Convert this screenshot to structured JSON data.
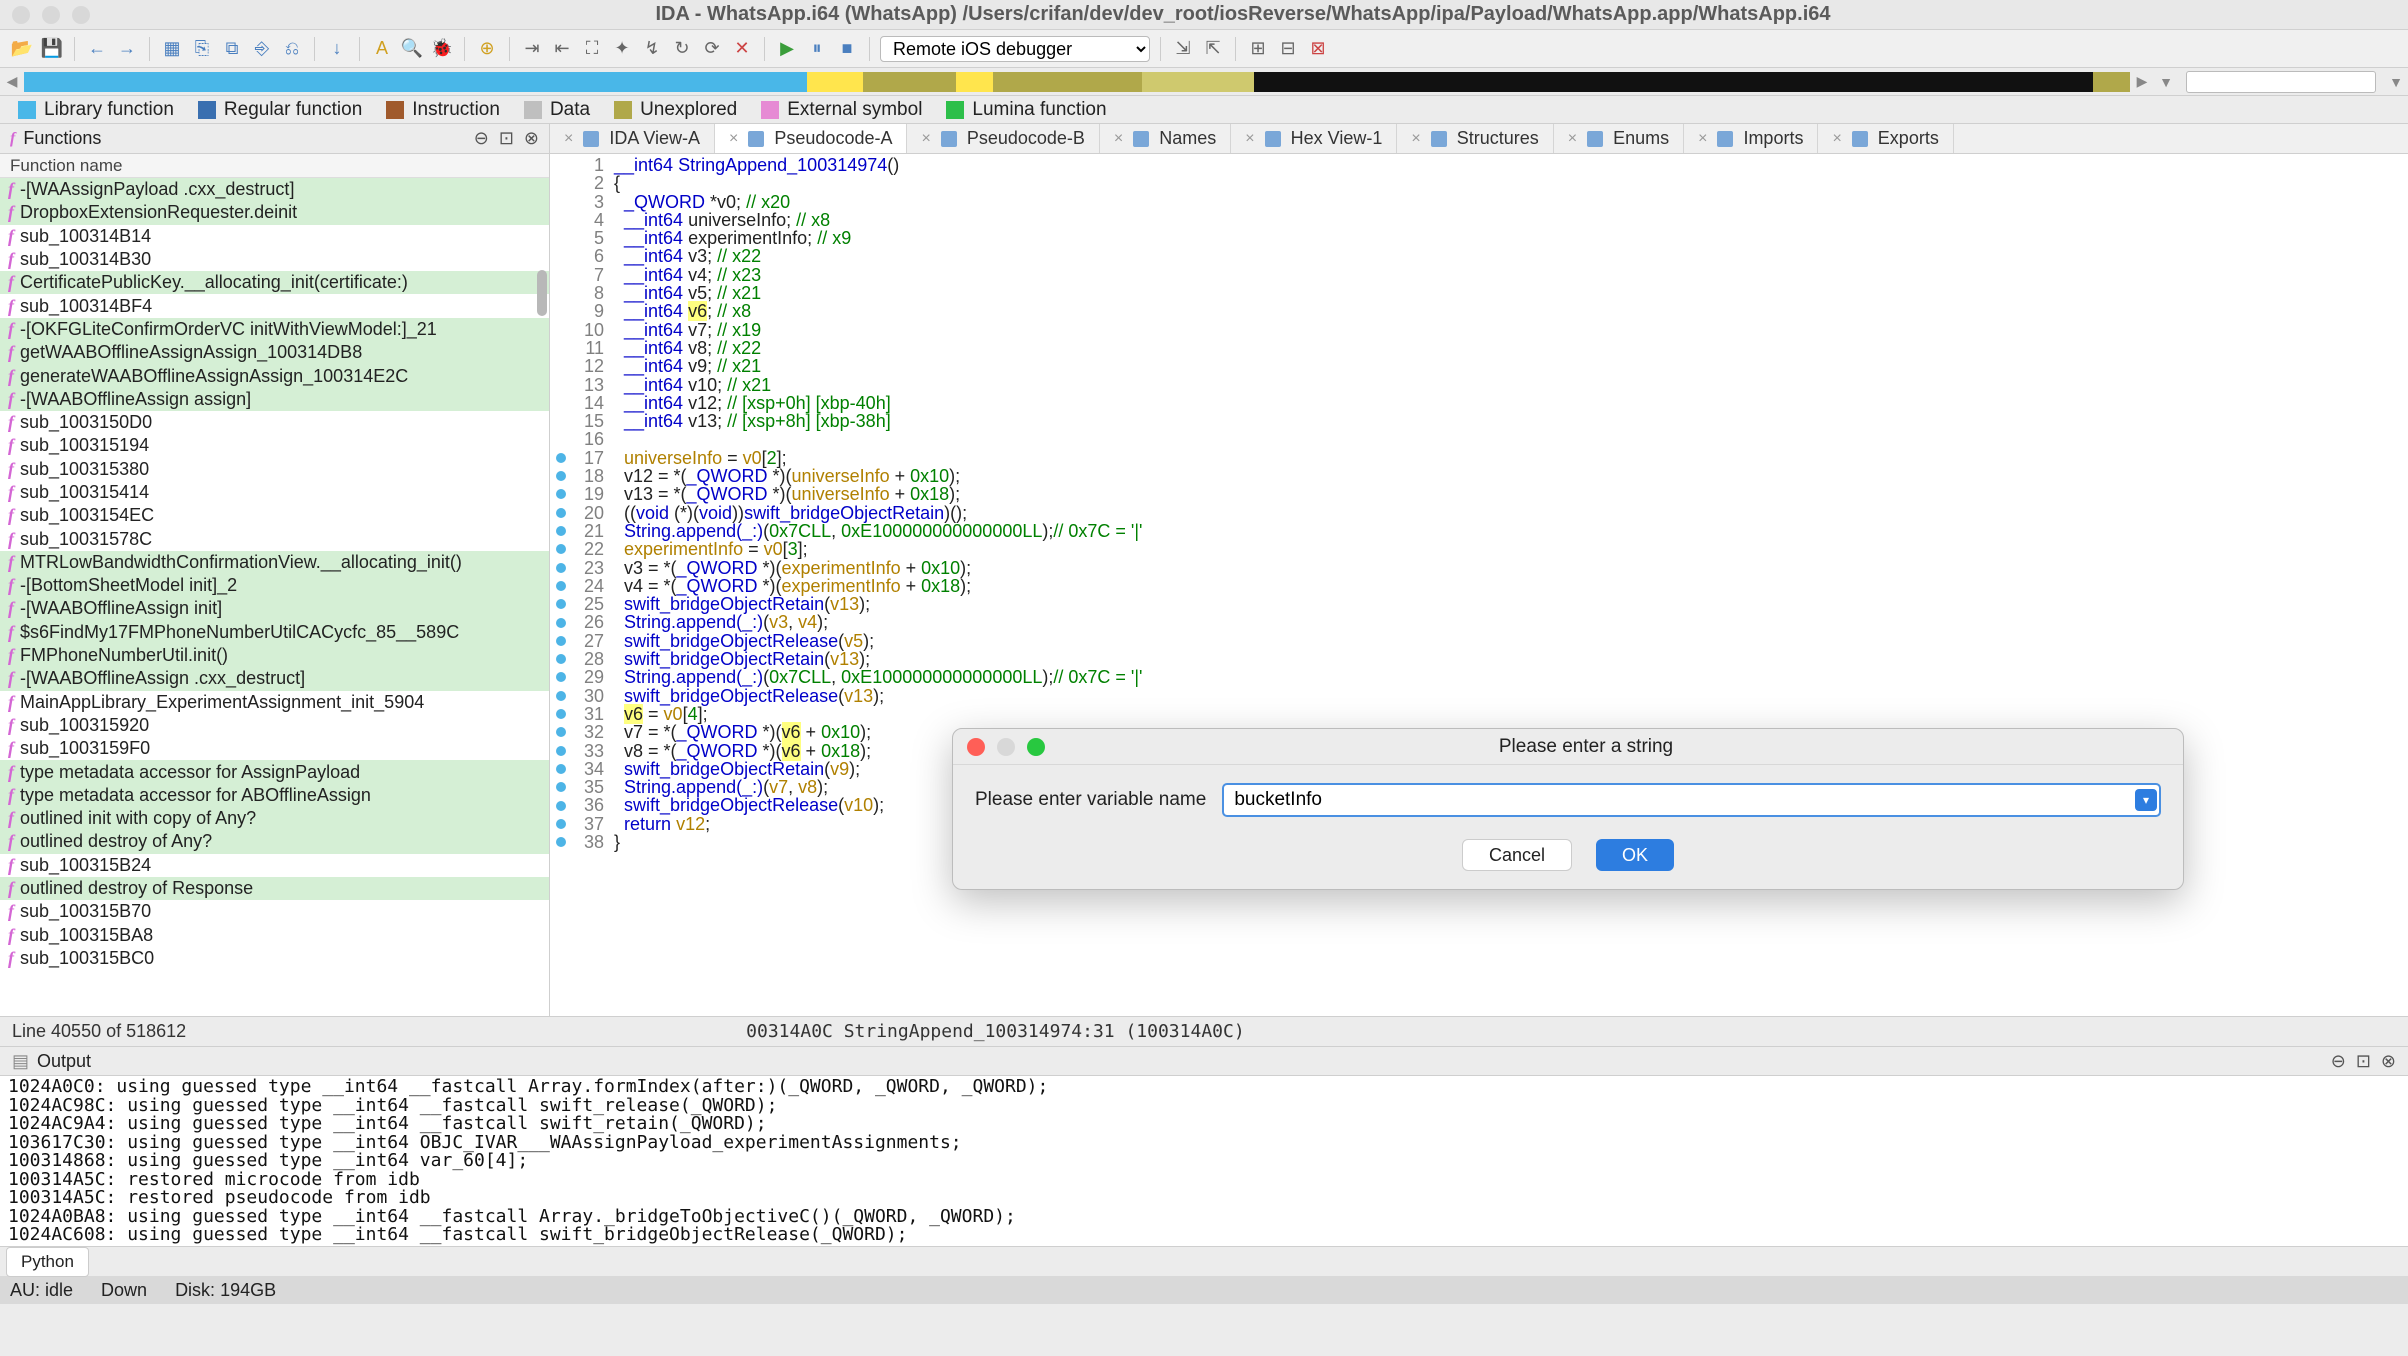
{
  "title": "IDA - WhatsApp.i64 (WhatsApp) /Users/crifan/dev/dev_root/iosReverse/WhatsApp/ipa/Payload/WhatsApp.app/WhatsApp.i64",
  "debugger_select": "Remote iOS debugger",
  "legend": {
    "libfunc": "Library function",
    "regfunc": "Regular function",
    "instruction": "Instruction",
    "data": "Data",
    "unexplored": "Unexplored",
    "extsym": "External symbol",
    "lumina": "Lumina function"
  },
  "functions_panel": {
    "title": "Functions",
    "column": "Function name",
    "items": [
      {
        "name": "-[WAAssignPayload .cxx_destruct]",
        "hl": true
      },
      {
        "name": "DropboxExtensionRequester.deinit",
        "hl": true
      },
      {
        "name": "sub_100314B14",
        "hl": false
      },
      {
        "name": "sub_100314B30",
        "hl": false
      },
      {
        "name": "CertificatePublicKey.__allocating_init(certificate:)",
        "hl": true
      },
      {
        "name": "sub_100314BF4",
        "hl": false
      },
      {
        "name": "-[OKFGLiteConfirmOrderVC initWithViewModel:]_21",
        "hl": true
      },
      {
        "name": "getWAABOfflineAssignAssign_100314DB8",
        "hl": true
      },
      {
        "name": "generateWAABOfflineAssignAssign_100314E2C",
        "hl": true
      },
      {
        "name": "-[WAABOfflineAssign assign]",
        "hl": true
      },
      {
        "name": "sub_1003150D0",
        "hl": false
      },
      {
        "name": "sub_100315194",
        "hl": false
      },
      {
        "name": "sub_100315380",
        "hl": false
      },
      {
        "name": "sub_100315414",
        "hl": false
      },
      {
        "name": "sub_1003154EC",
        "hl": false
      },
      {
        "name": "sub_10031578C",
        "hl": false
      },
      {
        "name": "MTRLowBandwidthConfirmationView.__allocating_init()",
        "hl": true
      },
      {
        "name": "-[BottomSheetModel init]_2",
        "hl": true
      },
      {
        "name": "-[WAABOfflineAssign init]",
        "hl": true
      },
      {
        "name": "$s6FindMy17FMPhoneNumberUtilCACycfc_85__589C",
        "hl": true
      },
      {
        "name": "FMPhoneNumberUtil.init()",
        "hl": true
      },
      {
        "name": "-[WAABOfflineAssign .cxx_destruct]",
        "hl": true
      },
      {
        "name": "MainAppLibrary_ExperimentAssignment_init_5904",
        "hl": false
      },
      {
        "name": "sub_100315920",
        "hl": false
      },
      {
        "name": "sub_1003159F0",
        "hl": false
      },
      {
        "name": "type metadata accessor for AssignPayload",
        "hl": true
      },
      {
        "name": "type metadata accessor for ABOfflineAssign",
        "hl": true
      },
      {
        "name": "outlined init with copy of Any?",
        "hl": true
      },
      {
        "name": "outlined destroy of Any?",
        "hl": true
      },
      {
        "name": "sub_100315B24",
        "hl": false
      },
      {
        "name": "outlined destroy of Response",
        "hl": true
      },
      {
        "name": "sub_100315B70",
        "hl": false
      },
      {
        "name": "sub_100315BA8",
        "hl": false
      },
      {
        "name": "sub_100315BC0",
        "hl": false
      }
    ]
  },
  "tabs": [
    {
      "label": "IDA View-A",
      "icon": "ida"
    },
    {
      "label": "Pseudocode-A",
      "icon": "pc",
      "active": true
    },
    {
      "label": "Pseudocode-B",
      "icon": "pc"
    },
    {
      "label": "Names",
      "icon": "names"
    },
    {
      "label": "Hex View-1",
      "icon": "hex"
    },
    {
      "label": "Structures",
      "icon": "struct"
    },
    {
      "label": "Enums",
      "icon": "enum"
    },
    {
      "label": "Imports",
      "icon": "imp"
    },
    {
      "label": "Exports",
      "icon": "exp"
    }
  ],
  "code_lines": [
    {
      "n": 1,
      "html": "<span class='ty'>__int64</span> <span class='fn'>StringAppend_100314974</span>()"
    },
    {
      "n": 2,
      "html": "{"
    },
    {
      "n": 3,
      "html": "  <span class='ty'>_QWORD</span> *<span>v0</span>; <span class='cm'>// x20</span>"
    },
    {
      "n": 4,
      "html": "  <span class='ty'>__int64</span> <span>universeInfo</span>; <span class='cm'>// x8</span>"
    },
    {
      "n": 5,
      "html": "  <span class='ty'>__int64</span> <span>experimentInfo</span>; <span class='cm'>// x9</span>"
    },
    {
      "n": 6,
      "html": "  <span class='ty'>__int64</span> v3; <span class='cm'>// x22</span>"
    },
    {
      "n": 7,
      "html": "  <span class='ty'>__int64</span> v4; <span class='cm'>// x23</span>"
    },
    {
      "n": 8,
      "html": "  <span class='ty'>__int64</span> v5; <span class='cm'>// x21</span>"
    },
    {
      "n": 9,
      "html": "  <span class='ty'>__int64</span> <span class='hl-y'>v6</span>; <span class='cm'>// x8</span>"
    },
    {
      "n": 10,
      "html": "  <span class='ty'>__int64</span> v7; <span class='cm'>// x19</span>"
    },
    {
      "n": 11,
      "html": "  <span class='ty'>__int64</span> v8; <span class='cm'>// x22</span>"
    },
    {
      "n": 12,
      "html": "  <span class='ty'>__int64</span> v9; <span class='cm'>// x21</span>"
    },
    {
      "n": 13,
      "html": "  <span class='ty'>__int64</span> v10; <span class='cm'>// x21</span>"
    },
    {
      "n": 14,
      "html": "  <span class='ty'>__int64</span> v12; <span class='cm'>// [xsp+0h] [xbp-40h]</span>"
    },
    {
      "n": 15,
      "html": "  <span class='ty'>__int64</span> v13; <span class='cm'>// [xsp+8h] [xbp-38h]</span>"
    },
    {
      "n": 16,
      "html": ""
    },
    {
      "n": 17,
      "bp": true,
      "html": "  <span class='var'>universeInfo</span> = <span class='var'>v0</span>[<span class='nm'>2</span>];"
    },
    {
      "n": 18,
      "bp": true,
      "html": "  v12 = *(<span class='ty'>_QWORD</span> *)(<span class='var'>universeInfo</span> + <span class='nm'>0x10</span>);"
    },
    {
      "n": 19,
      "bp": true,
      "html": "  v13 = *(<span class='ty'>_QWORD</span> *)(<span class='var'>universeInfo</span> + <span class='nm'>0x18</span>);"
    },
    {
      "n": 20,
      "bp": true,
      "html": "  ((<span class='ty'>void</span> (*)(<span class='ty'>void</span>))<span class='fn'>swift_bridgeObjectRetain</span>)();"
    },
    {
      "n": 21,
      "bp": true,
      "html": "  <span class='fn'>String.append(_:)</span>(<span class='nm'>0x7CLL</span>, <span class='nm'>0xE100000000000000LL</span>);<span class='cm'>// 0x7C = '|'</span>"
    },
    {
      "n": 22,
      "bp": true,
      "html": "  <span class='var'>experimentInfo</span> = <span class='var'>v0</span>[<span class='nm'>3</span>];"
    },
    {
      "n": 23,
      "bp": true,
      "html": "  v3 = *(<span class='ty'>_QWORD</span> *)(<span class='var'>experimentInfo</span> + <span class='nm'>0x10</span>);"
    },
    {
      "n": 24,
      "bp": true,
      "html": "  v4 = *(<span class='ty'>_QWORD</span> *)(<span class='var'>experimentInfo</span> + <span class='nm'>0x18</span>);"
    },
    {
      "n": 25,
      "bp": true,
      "html": "  <span class='fn'>swift_bridgeObjectRetain</span>(<span class='var'>v13</span>);"
    },
    {
      "n": 26,
      "bp": true,
      "html": "  <span class='fn'>String.append(_:)</span>(<span class='var'>v3</span>, <span class='var'>v4</span>);"
    },
    {
      "n": 27,
      "bp": true,
      "html": "  <span class='fn'>swift_bridgeObjectRelease</span>(<span class='var'>v5</span>);"
    },
    {
      "n": 28,
      "bp": true,
      "html": "  <span class='fn'>swift_bridgeObjectRetain</span>(<span class='var'>v13</span>);"
    },
    {
      "n": 29,
      "bp": true,
      "html": "  <span class='fn'>String.append(_:)</span>(<span class='nm'>0x7CLL</span>, <span class='nm'>0xE100000000000000LL</span>);<span class='cm'>// 0x7C = '|'</span>"
    },
    {
      "n": 30,
      "bp": true,
      "html": "  <span class='fn'>swift_bridgeObjectRelease</span>(<span class='var'>v13</span>);"
    },
    {
      "n": 31,
      "bp": true,
      "html": "  <span class='hl-y'>v6</span> = <span class='var'>v0</span>[<span class='nm'>4</span>];"
    },
    {
      "n": 32,
      "bp": true,
      "html": "  v7 = *(<span class='ty'>_QWORD</span> *)(<span class='hl-y'>v6</span> + <span class='nm'>0x10</span>);"
    },
    {
      "n": 33,
      "bp": true,
      "html": "  v8 = *(<span class='ty'>_QWORD</span> *)(<span class='hl-y'>v6</span> + <span class='nm'>0x18</span>);"
    },
    {
      "n": 34,
      "bp": true,
      "html": "  <span class='fn'>swift_bridgeObjectRetain</span>(<span class='var'>v9</span>);"
    },
    {
      "n": 35,
      "bp": true,
      "html": "  <span class='fn'>String.append(_:)</span>(<span class='var'>v7</span>, <span class='var'>v8</span>);"
    },
    {
      "n": 36,
      "bp": true,
      "html": "  <span class='fn'>swift_bridgeObjectRelease</span>(<span class='var'>v10</span>);"
    },
    {
      "n": 37,
      "bp": true,
      "html": "  <span class='kw'>return</span> <span class='var'>v12</span>;"
    },
    {
      "n": 38,
      "bp": true,
      "html": "}"
    }
  ],
  "status_left": "Line 40550 of 518612",
  "status_addr": "00314A0C StringAppend_100314974:31 (100314A0C)",
  "output_title": "Output",
  "output_lines": [
    "1024A0C0: using guessed type __int64 __fastcall Array.formIndex(after:)(_QWORD, _QWORD, _QWORD);",
    "1024AC98C: using guessed type __int64 __fastcall swift_release(_QWORD);",
    "1024AC9A4: using guessed type __int64 __fastcall swift_retain(_QWORD);",
    "103617C30: using guessed type __int64 OBJC_IVAR___WAAssignPayload_experimentAssignments;",
    "100314868: using guessed type __int64 var_60[4];",
    "100314A5C: restored microcode from idb",
    "100314A5C: restored pseudocode from idb",
    "1024A0BA8: using guessed type __int64 __fastcall Array._bridgeToObjectiveC()(_QWORD, _QWORD);",
    "1024AC608: using guessed type __int64 __fastcall swift_bridgeObjectRelease(_QWORD);"
  ],
  "python_tab": "Python",
  "bottom_status": {
    "au": "AU:  idle",
    "down": "Down",
    "disk": "Disk: 194GB"
  },
  "modal": {
    "title": "Please enter a string",
    "label": "Please enter variable name",
    "value": "bucketInfo",
    "cancel": "Cancel",
    "ok": "OK"
  },
  "navmap_segments": [
    {
      "color": "#49b7e8",
      "flex": 42
    },
    {
      "color": "#ffe54d",
      "flex": 3
    },
    {
      "color": "#b0a84a",
      "flex": 5
    },
    {
      "color": "#ffe54d",
      "flex": 2
    },
    {
      "color": "#b0a84a",
      "flex": 8
    },
    {
      "color": "#cfc96e",
      "flex": 6
    },
    {
      "color": "#111111",
      "flex": 45
    },
    {
      "color": "#b0a84a",
      "flex": 2
    }
  ]
}
